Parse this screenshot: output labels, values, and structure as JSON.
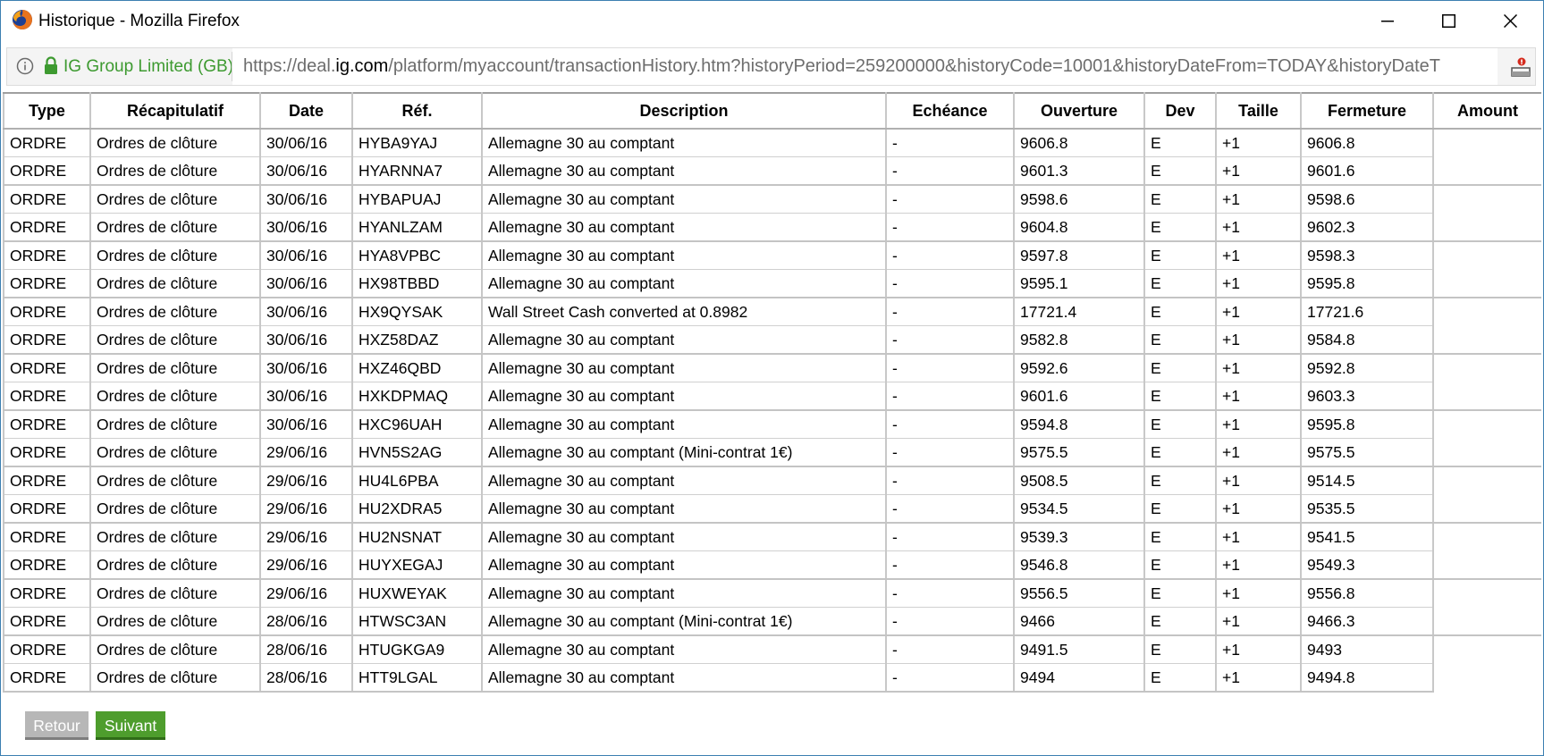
{
  "window": {
    "title": "Historique - Mozilla Firefox"
  },
  "urlbar": {
    "organization": "IG Group Limited (GB)",
    "url_prefix": "https://deal.",
    "url_domain": "ig.com",
    "url_path": "/platform/myaccount/transactionHistory.htm?historyPeriod=259200000&historyCode=10001&historyDateFrom=TODAY&historyDateT"
  },
  "table": {
    "headers": [
      "Type",
      "Récapitulatif",
      "Date",
      "Réf.",
      "Description",
      "Echéance",
      "Ouverture",
      "Dev",
      "Taille",
      "Fermeture",
      "Amount"
    ],
    "rows": [
      [
        "ORDRE",
        "Ordres de clôture",
        "30/06/16",
        "HYBA9YAJ",
        "Allemagne 30 au comptant",
        "-",
        "9606.8",
        "E",
        "+1",
        "9606.8"
      ],
      [
        "ORDRE",
        "Ordres de clôture",
        "30/06/16",
        "HYARNNA7",
        "Allemagne 30 au comptant",
        "-",
        "9601.3",
        "E",
        "+1",
        "9601.6"
      ],
      [
        "ORDRE",
        "Ordres de clôture",
        "30/06/16",
        "HYBAPUAJ",
        "Allemagne 30 au comptant",
        "-",
        "9598.6",
        "E",
        "+1",
        "9598.6"
      ],
      [
        "ORDRE",
        "Ordres de clôture",
        "30/06/16",
        "HYANLZAM",
        "Allemagne 30 au comptant",
        "-",
        "9604.8",
        "E",
        "+1",
        "9602.3"
      ],
      [
        "ORDRE",
        "Ordres de clôture",
        "30/06/16",
        "HYA8VPBC",
        "Allemagne 30 au comptant",
        "-",
        "9597.8",
        "E",
        "+1",
        "9598.3"
      ],
      [
        "ORDRE",
        "Ordres de clôture",
        "30/06/16",
        "HX98TBBD",
        "Allemagne 30 au comptant",
        "-",
        "9595.1",
        "E",
        "+1",
        "9595.8"
      ],
      [
        "ORDRE",
        "Ordres de clôture",
        "30/06/16",
        "HX9QYSAK",
        "Wall Street Cash converted at 0.8982",
        "-",
        "17721.4",
        "E",
        "+1",
        "17721.6"
      ],
      [
        "ORDRE",
        "Ordres de clôture",
        "30/06/16",
        "HXZ58DAZ",
        "Allemagne 30 au comptant",
        "-",
        "9582.8",
        "E",
        "+1",
        "9584.8"
      ],
      [
        "ORDRE",
        "Ordres de clôture",
        "30/06/16",
        "HXZ46QBD",
        "Allemagne 30 au comptant",
        "-",
        "9592.6",
        "E",
        "+1",
        "9592.8"
      ],
      [
        "ORDRE",
        "Ordres de clôture",
        "30/06/16",
        "HXKDPMAQ",
        "Allemagne 30 au comptant",
        "-",
        "9601.6",
        "E",
        "+1",
        "9603.3"
      ],
      [
        "ORDRE",
        "Ordres de clôture",
        "30/06/16",
        "HXC96UAH",
        "Allemagne 30 au comptant",
        "-",
        "9594.8",
        "E",
        "+1",
        "9595.8"
      ],
      [
        "ORDRE",
        "Ordres de clôture",
        "29/06/16",
        "HVN5S2AG",
        "Allemagne 30 au comptant (Mini-contrat 1€)",
        "-",
        "9575.5",
        "E",
        "+1",
        "9575.5"
      ],
      [
        "ORDRE",
        "Ordres de clôture",
        "29/06/16",
        "HU4L6PBA",
        "Allemagne 30 au comptant",
        "-",
        "9508.5",
        "E",
        "+1",
        "9514.5"
      ],
      [
        "ORDRE",
        "Ordres de clôture",
        "29/06/16",
        "HU2XDRA5",
        "Allemagne 30 au comptant",
        "-",
        "9534.5",
        "E",
        "+1",
        "9535.5"
      ],
      [
        "ORDRE",
        "Ordres de clôture",
        "29/06/16",
        "HU2NSNAT",
        "Allemagne 30 au comptant",
        "-",
        "9539.3",
        "E",
        "+1",
        "9541.5"
      ],
      [
        "ORDRE",
        "Ordres de clôture",
        "29/06/16",
        "HUYXEGAJ",
        "Allemagne 30 au comptant",
        "-",
        "9546.8",
        "E",
        "+1",
        "9549.3"
      ],
      [
        "ORDRE",
        "Ordres de clôture",
        "29/06/16",
        "HUXWEYAK",
        "Allemagne 30 au comptant",
        "-",
        "9556.5",
        "E",
        "+1",
        "9556.8"
      ],
      [
        "ORDRE",
        "Ordres de clôture",
        "28/06/16",
        "HTWSC3AN",
        "Allemagne 30 au comptant (Mini-contrat 1€)",
        "-",
        "9466",
        "E",
        "+1",
        "9466.3"
      ],
      [
        "ORDRE",
        "Ordres de clôture",
        "28/06/16",
        "HTUGKGA9",
        "Allemagne 30 au comptant",
        "-",
        "9491.5",
        "E",
        "+1",
        "9493"
      ],
      [
        "ORDRE",
        "Ordres de clôture",
        "28/06/16",
        "HTT9LGAL",
        "Allemagne 30 au comptant",
        "-",
        "9494",
        "E",
        "+1",
        "9494.8"
      ]
    ]
  },
  "buttons": {
    "back": "Retour",
    "next": "Suivant"
  },
  "colors": {
    "org_green": "#3d9a30",
    "next_button": "#4e9d2d",
    "back_button": "#b7b7b7"
  }
}
